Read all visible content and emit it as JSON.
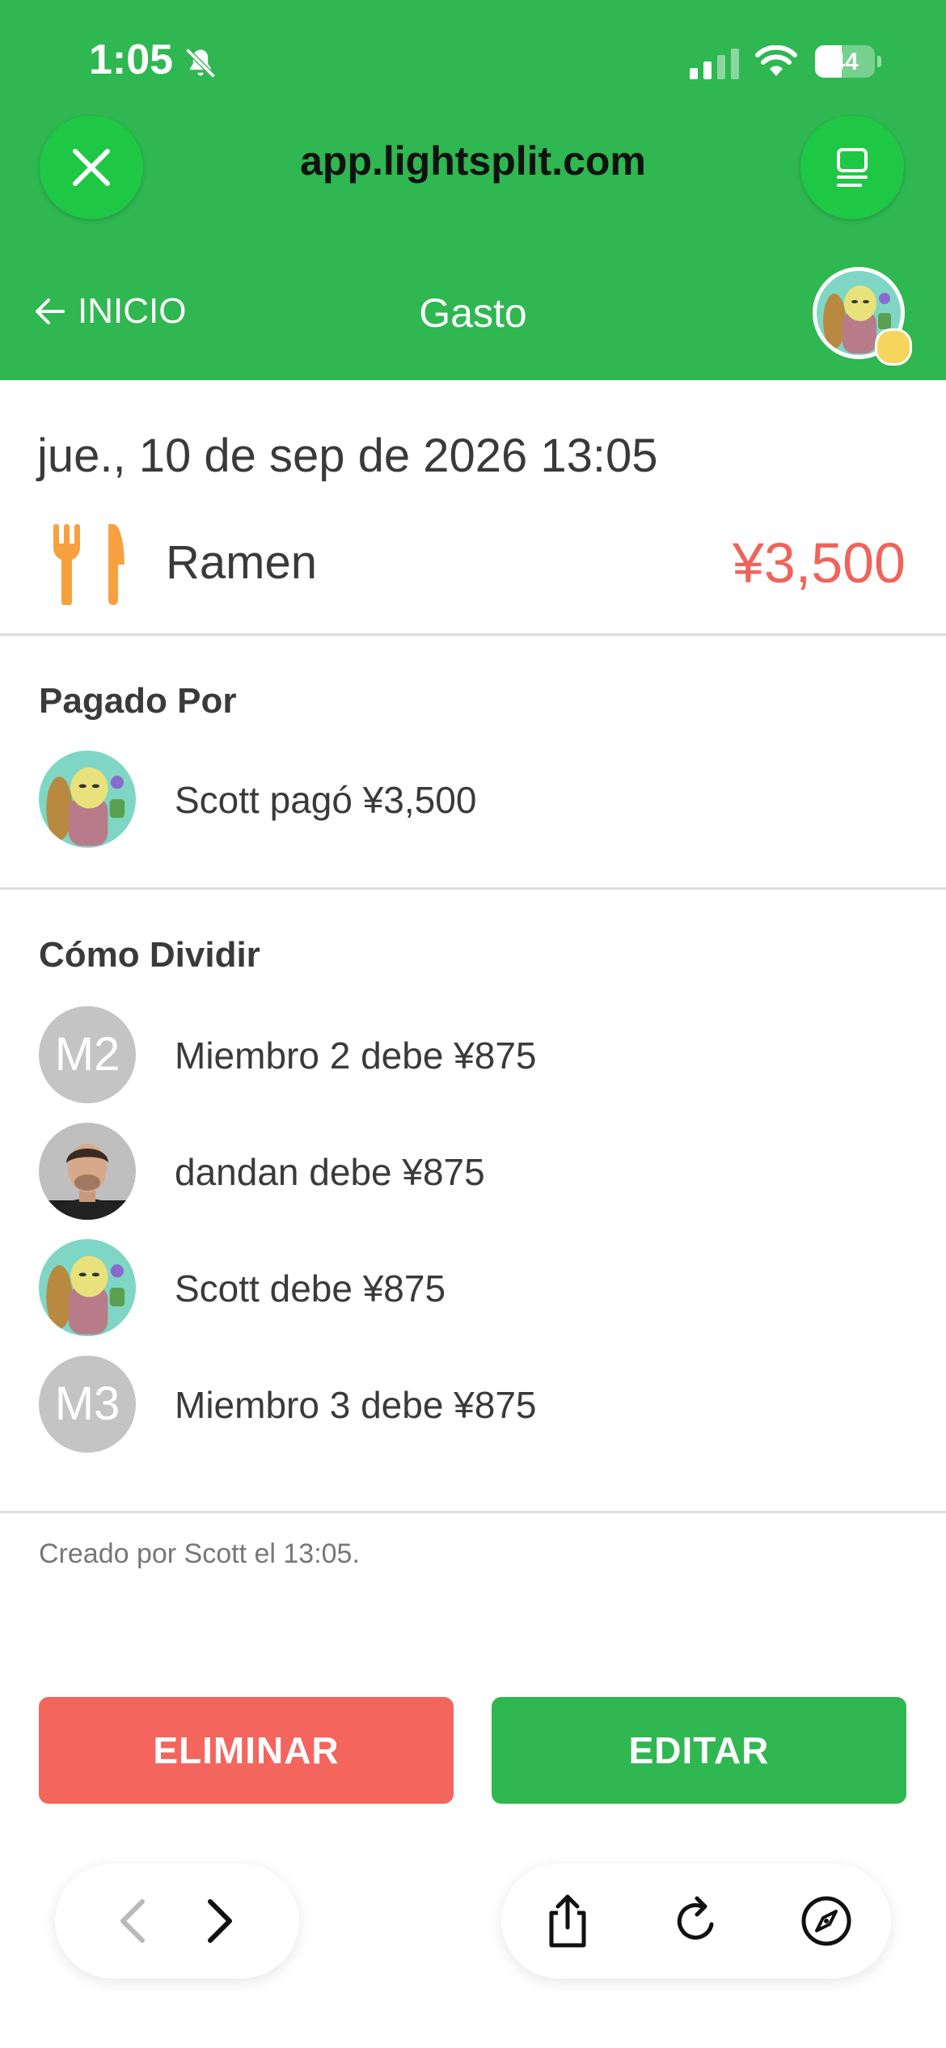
{
  "status_bar": {
    "time": "1:05",
    "battery": "44",
    "battery_level": 0.44
  },
  "browser": {
    "url": "app.lightsplit.com"
  },
  "nav": {
    "back_label": "INICIO",
    "title": "Gasto"
  },
  "expense": {
    "date": "jue., 10 de sep de 2026 13:05",
    "name": "Ramen",
    "amount": "¥3,500",
    "category_icon": "fork-knife-icon"
  },
  "paid_by": {
    "title": "Pagado Por",
    "items": [
      {
        "text": "Scott pagó ¥3,500",
        "avatar": "cartoon"
      }
    ]
  },
  "split": {
    "title": "Cómo Dividir",
    "items": [
      {
        "initials": "M2",
        "text": "Miembro 2 debe ¥875"
      },
      {
        "initials": "",
        "text": "dandan debe ¥875"
      },
      {
        "initials": "",
        "text": "Scott debe ¥875"
      },
      {
        "initials": "M3",
        "text": "Miembro 3 debe ¥875"
      }
    ]
  },
  "created_text": "Creado por Scott el 13:05.",
  "actions": {
    "delete_label": "ELIMINAR",
    "edit_label": "EDITAR"
  },
  "colors": {
    "brand_green": "#2fb751",
    "danger_red": "#f4655d",
    "amount_red": "#f0635a"
  }
}
